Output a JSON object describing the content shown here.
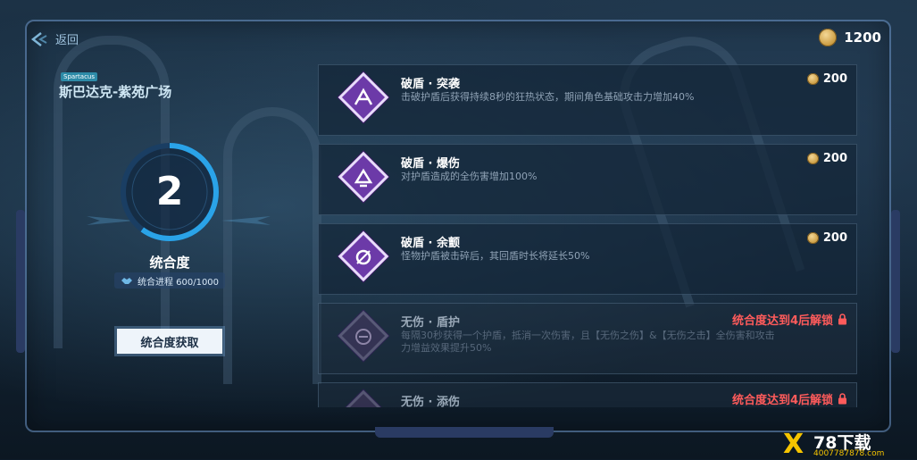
{
  "nav": {
    "back_label": "返回"
  },
  "currency": {
    "icon": "coin-icon",
    "amount": "1200"
  },
  "map": {
    "tag": "Spartacus",
    "title": "斯巴达克-紫苑广场"
  },
  "level": {
    "value": "2",
    "label": "统合度",
    "progress_text": "统合进程 600/1000",
    "progress_fraction": 0.6,
    "acquire_button": "统合度获取"
  },
  "talents": [
    {
      "name": "破盾 · 突袭",
      "desc": "击破护盾后获得持续8秒的狂热状态，期间角色基础攻击力增加40%",
      "cost": "200",
      "locked": false,
      "lock_text": ""
    },
    {
      "name": "破盾 · 爆伤",
      "desc": "对护盾造成的全伤害增加100%",
      "cost": "200",
      "locked": false,
      "lock_text": ""
    },
    {
      "name": "破盾 · 余颤",
      "desc": "怪物护盾被击碎后，其回盾时长将延长50%",
      "cost": "200",
      "locked": false,
      "lock_text": ""
    },
    {
      "name": "无伤 · 盾护",
      "desc": "每隔30秒获得一个护盾，抵消一次伤害，且【无伤之伤】&【无伤之击】全伤害和攻击力增益效果提升50%",
      "cost": "",
      "locked": true,
      "lock_text": "统合度达到4后解锁"
    },
    {
      "name": "无伤 · 添伤",
      "desc": "",
      "cost": "",
      "locked": true,
      "lock_text": "统合度达到4后解锁"
    }
  ],
  "watermark": {
    "brand": "78下载",
    "url": "4007787878.com"
  },
  "colors": {
    "accent": "#3aa6e0",
    "talent_purple": "#6c3aa8",
    "lock_red": "#ff5b5b",
    "coin_gold": "#d9a84a"
  }
}
